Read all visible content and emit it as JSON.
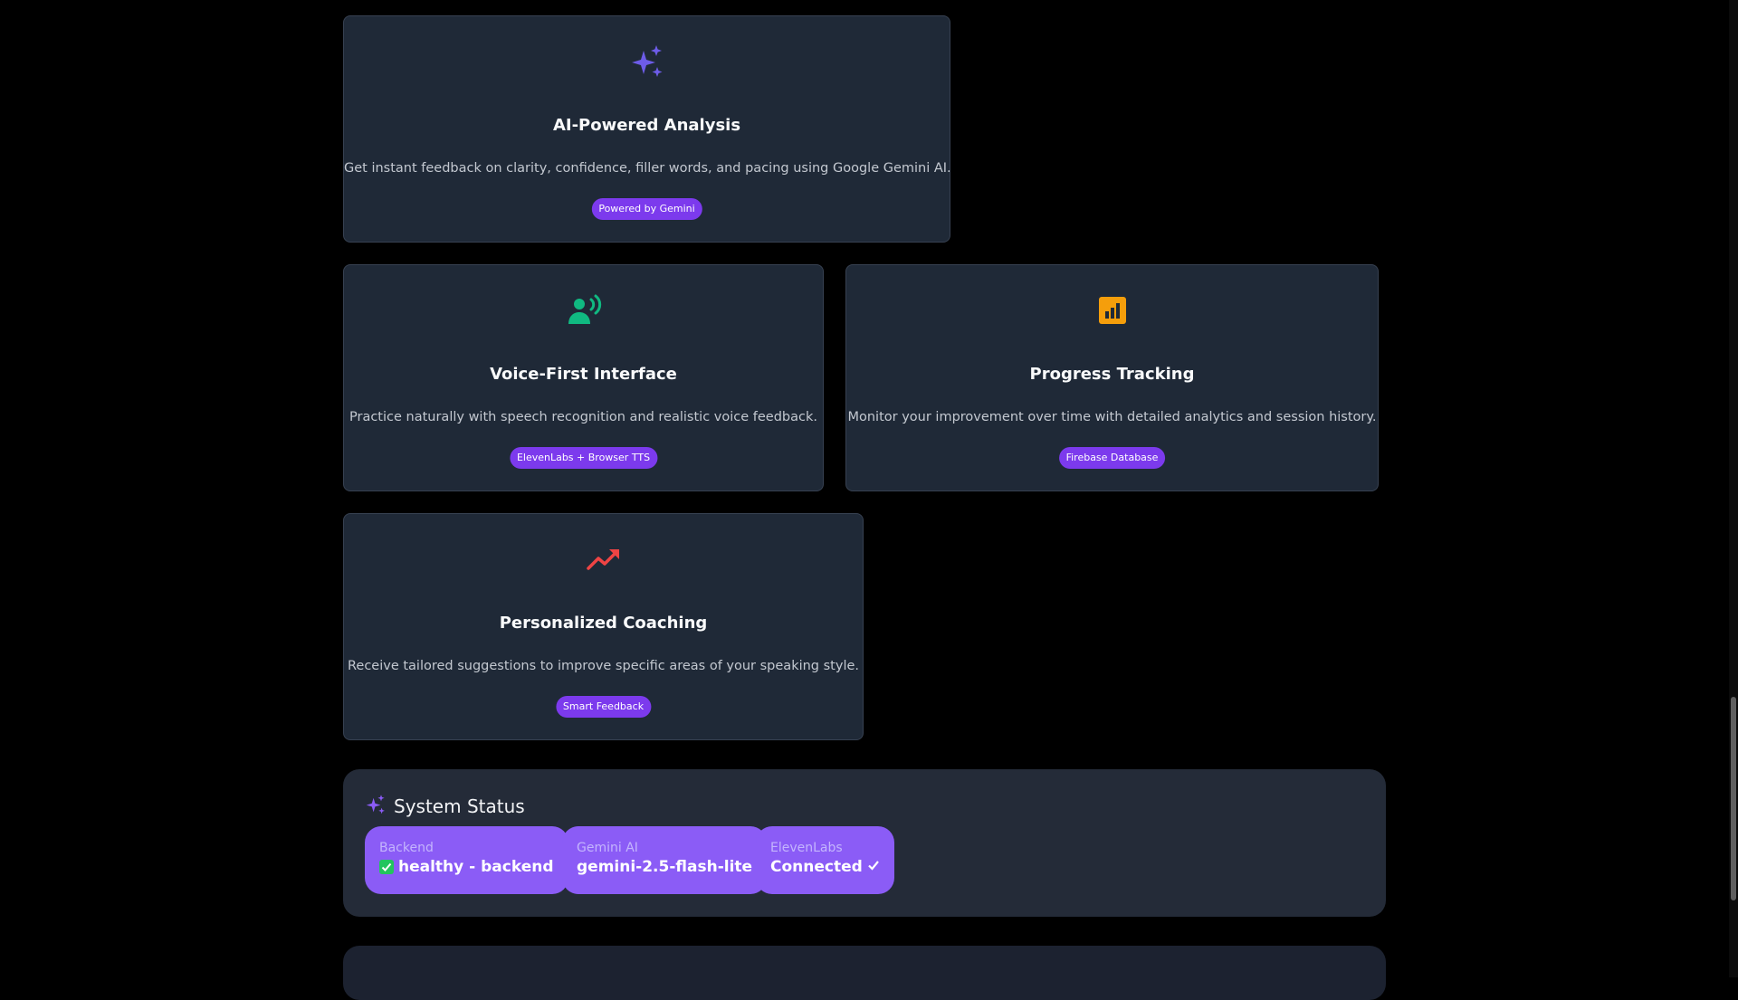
{
  "features": [
    {
      "title": "AI-Powered Analysis",
      "description": "Get instant feedback on clarity, confidence, filler words, and pacing using Google Gemini AI.",
      "badge": "Powered by Gemini",
      "icon": "sparkles-icon",
      "icon_color": "#6d5ce8"
    },
    {
      "title": "Voice-First Interface",
      "description": "Practice naturally with speech recognition and realistic voice feedback.",
      "badge": "ElevenLabs + Browser TTS",
      "icon": "voice-user-icon",
      "icon_color": "#10b981"
    },
    {
      "title": "Progress Tracking",
      "description": "Monitor your improvement over time with detailed analytics and session history.",
      "badge": "Firebase Database",
      "icon": "bar-chart-icon",
      "icon_color": "#f59e0b"
    },
    {
      "title": "Personalized Coaching",
      "description": "Receive tailored suggestions to improve specific areas of your speaking style.",
      "badge": "Smart Feedback",
      "icon": "trending-up-icon",
      "icon_color": "#ef4444"
    }
  ],
  "status": {
    "title": "System Status",
    "items": [
      {
        "label": "Backend",
        "value": "healthy - backend",
        "prefix_icon": "check-box-icon"
      },
      {
        "label": "Gemini AI",
        "value": "gemini-2.5-flash-lite"
      },
      {
        "label": "ElevenLabs",
        "value": "Connected",
        "suffix_icon": "checkmark-icon"
      }
    ]
  },
  "colors": {
    "accent": "#7c3aed",
    "pill": "#8b5cf6",
    "card_bg": "#1f2937",
    "page_bg": "#000000"
  }
}
